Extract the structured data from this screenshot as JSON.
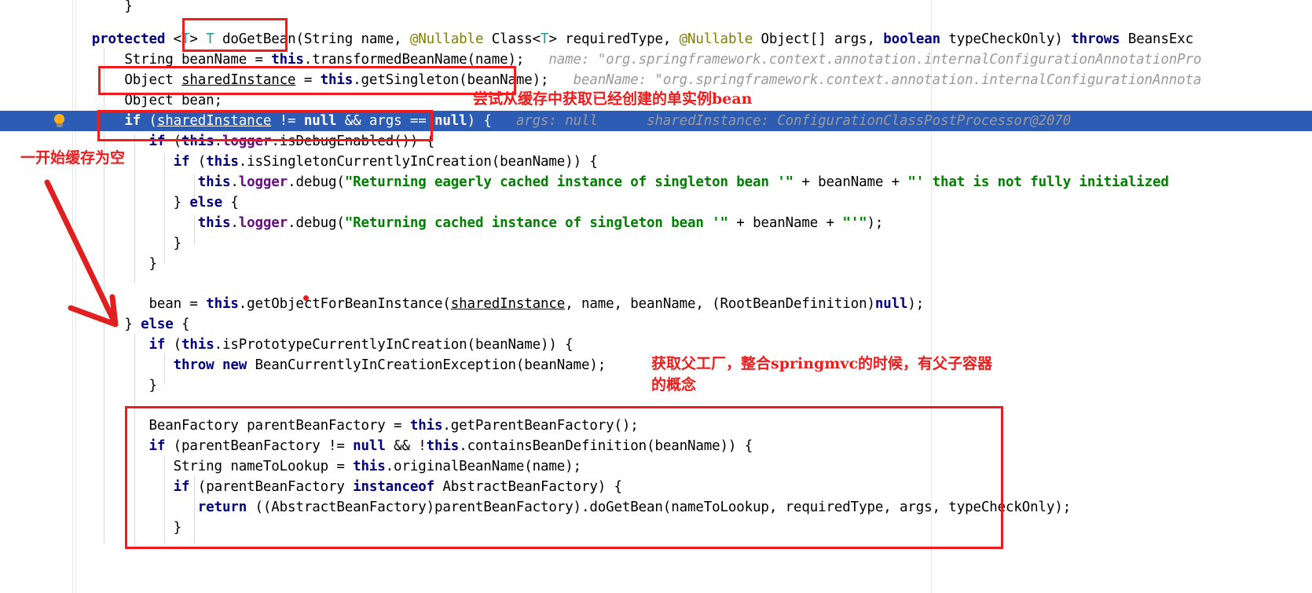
{
  "editor": {
    "language": "java",
    "selected_line_bg": "#2d5cb5",
    "accent_red": "#ee1c1c",
    "gutter_icon": "lightbulb-icon",
    "lines": [
      {
        "id": "l0",
        "indent": 0,
        "text": "}"
      },
      {
        "id": "l1",
        "text": "protected <T> T doGetBean(String name, @Nullable Class<T> requiredType, @Nullable Object[] args, boolean typeCheckOnly) throws BeansExc"
      },
      {
        "id": "l2",
        "text": "String beanName = this.transformedBeanName(name);",
        "hint": "name: \"org.springframework.context.annotation.internalConfigurationAnnotationPro"
      },
      {
        "id": "l3",
        "text": "Object sharedInstance = this.getSingleton(beanName);",
        "hint": "beanName: \"org.springframework.context.annotation.internalConfigurationAnnota"
      },
      {
        "id": "l4",
        "text": "Object bean;"
      },
      {
        "id": "l5",
        "text": "if (sharedInstance != null && args == null) {",
        "hint": "args: null      sharedInstance: ConfigurationClassPostProcessor@2070",
        "selected": true
      },
      {
        "id": "l6",
        "text": "if (this.logger.isDebugEnabled()) {"
      },
      {
        "id": "l7",
        "text": "if (this.isSingletonCurrentlyInCreation(beanName)) {"
      },
      {
        "id": "l8",
        "text": "this.logger.debug(\"Returning eagerly cached instance of singleton bean '\" + beanName + \"' that is not fully initialized"
      },
      {
        "id": "l9",
        "text": "} else {"
      },
      {
        "id": "l10",
        "text": "this.logger.debug(\"Returning cached instance of singleton bean '\" + beanName + \"'\");"
      },
      {
        "id": "l11",
        "text": "}"
      },
      {
        "id": "l12",
        "text": "}"
      },
      {
        "id": "l13",
        "text": ""
      },
      {
        "id": "l14",
        "text": "bean = this.getObjectForBeanInstance(sharedInstance, name, beanName, (RootBeanDefinition)null);"
      },
      {
        "id": "l15",
        "text": "} else {"
      },
      {
        "id": "l16",
        "text": "if (this.isPrototypeCurrentlyInCreation(beanName)) {"
      },
      {
        "id": "l17",
        "text": "throw new BeanCurrentlyInCreationException(beanName);"
      },
      {
        "id": "l18",
        "text": "}"
      },
      {
        "id": "l19",
        "text": ""
      },
      {
        "id": "l20",
        "text": "BeanFactory parentBeanFactory = this.getParentBeanFactory();"
      },
      {
        "id": "l21",
        "text": "if (parentBeanFactory != null && !this.containsBeanDefinition(beanName)) {"
      },
      {
        "id": "l22",
        "text": "String nameToLookup = this.originalBeanName(name);"
      },
      {
        "id": "l23",
        "text": "if (parentBeanFactory instanceof AbstractBeanFactory) {"
      },
      {
        "id": "l24",
        "text": "return ((AbstractBeanFactory)parentBeanFactory).doGetBean(nameToLookup, requiredType, args, typeCheckOnly);"
      },
      {
        "id": "l25",
        "text": "}"
      }
    ]
  },
  "annotations": {
    "notes": [
      {
        "id": "note-cache-get",
        "text": "尝试从缓存中获取已经创建的单实例bean"
      },
      {
        "id": "note-cache-empty",
        "text": "一开始缓存为空"
      },
      {
        "id": "note-parent-factory-l1",
        "text": "获取父工厂，整合springmvc的时候，有父子容器"
      },
      {
        "id": "note-parent-factory-l2",
        "text": "的概念"
      }
    ],
    "boxes": [
      {
        "id": "box-dogetbean-name"
      },
      {
        "id": "box-shared-instance-line"
      },
      {
        "id": "box-if-shared-instance"
      },
      {
        "id": "box-parent-bean-factory"
      }
    ],
    "arrows": [
      {
        "id": "arrow-cache-empty-to-else"
      }
    ]
  }
}
